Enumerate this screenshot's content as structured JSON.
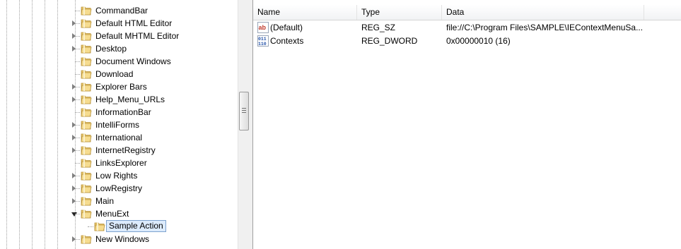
{
  "tree": {
    "items": [
      {
        "label": "CommandBar",
        "expander": "none"
      },
      {
        "label": "Default HTML Editor",
        "expander": "collapsed"
      },
      {
        "label": "Default MHTML Editor",
        "expander": "collapsed"
      },
      {
        "label": "Desktop",
        "expander": "collapsed"
      },
      {
        "label": "Document Windows",
        "expander": "none"
      },
      {
        "label": "Download",
        "expander": "none"
      },
      {
        "label": "Explorer Bars",
        "expander": "collapsed"
      },
      {
        "label": "Help_Menu_URLs",
        "expander": "collapsed"
      },
      {
        "label": "InformationBar",
        "expander": "none"
      },
      {
        "label": "IntelliForms",
        "expander": "collapsed"
      },
      {
        "label": "International",
        "expander": "collapsed"
      },
      {
        "label": "InternetRegistry",
        "expander": "collapsed"
      },
      {
        "label": "LinksExplorer",
        "expander": "none"
      },
      {
        "label": "Low Rights",
        "expander": "collapsed"
      },
      {
        "label": "LowRegistry",
        "expander": "collapsed"
      },
      {
        "label": "Main",
        "expander": "collapsed"
      },
      {
        "label": "MenuExt",
        "expander": "expanded"
      },
      {
        "label": "Sample Action",
        "expander": "child-selected"
      },
      {
        "label": "New Windows",
        "expander": "collapsed"
      }
    ]
  },
  "list": {
    "columns": [
      "Name",
      "Type",
      "Data"
    ],
    "rows": [
      {
        "icon": "string-value-icon",
        "name": "(Default)",
        "type": "REG_SZ",
        "data": "file://C:\\Program Files\\SAMPLE\\IEContextMenuSa..."
      },
      {
        "icon": "binary-value-icon",
        "name": "Contexts",
        "type": "REG_DWORD",
        "data": "0x00000010 (16)"
      }
    ]
  },
  "colors": {
    "folder": "#e8c66a",
    "selection": "#dcebfc",
    "selection_border": "#7da2ce"
  }
}
